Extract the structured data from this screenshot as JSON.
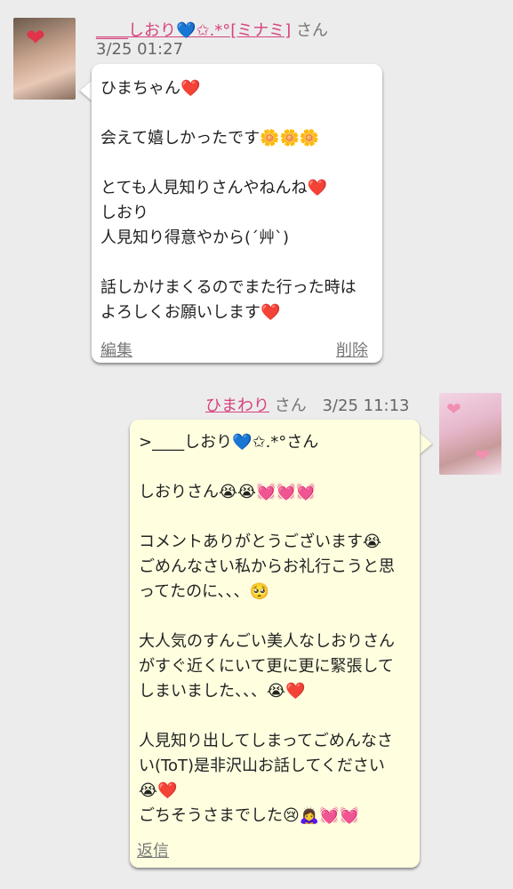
{
  "comments": [
    {
      "author_prefix": "____",
      "author_name": "しおり💙✩.*°[ミナミ]",
      "honorific": "さん",
      "timestamp": "3/25 01:27",
      "avatar_icon": "profile-photo-icon",
      "lines": [
        "ひまちゃん❤️",
        "",
        "会えて嬉しかったです🌼🌼🌼",
        "",
        "とても人見知りさんやねんね❤️",
        "しおり",
        "人見知り得意やから(´艸`)",
        "",
        "話しかけまくるのでまた行った時は",
        "よろしくお願いします❤️"
      ],
      "actions": {
        "edit": "編集",
        "delete": "削除"
      }
    },
    {
      "author_name": "ひまわり",
      "honorific": "さん",
      "timestamp": "3/25 11:13",
      "avatar_icon": "profile-photo-icon",
      "lines": [
        ">____しおり💙✩.*°さん",
        "",
        "しおりさん😭😭💓💓💓",
        "",
        "コメントありがとうございます😭",
        "ごめんなさい私からお礼行こうと思",
        "ってたのに、、、🥺",
        "",
        "大人気のすんごい美人なしおりさん",
        "がすぐ近くにいて更に更に緊張して",
        "しまいました、、、😭❤️",
        "",
        "人見知り出してしまってごめんなさ",
        "い(ToT)是非沢山お話してください",
        "😭❤️",
        "ごちそうさまでした😢🙇‍♀️💓💓"
      ],
      "actions": {
        "reply": "返信"
      }
    }
  ],
  "colors": {
    "background": "#ececec",
    "name_link": "#d6427f",
    "left_bubble": "#ffffff",
    "right_bubble": "#ffffe0"
  }
}
